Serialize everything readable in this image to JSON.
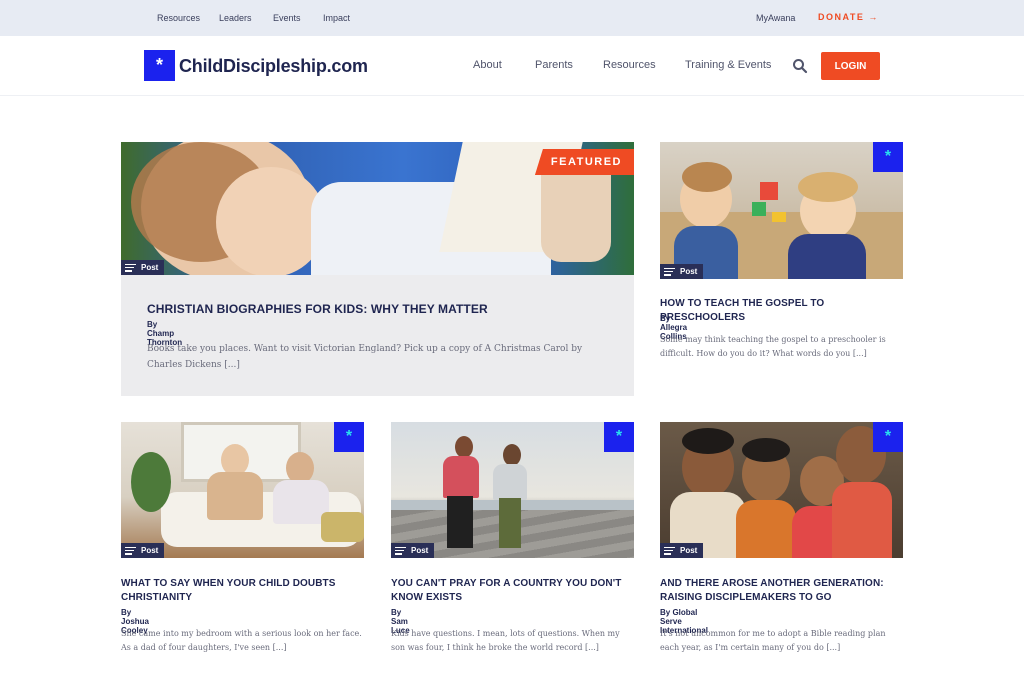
{
  "utility": {
    "links": [
      "Resources",
      "Leaders",
      "Events",
      "Impact"
    ],
    "myawana": "MyAwana",
    "donate": "DONATE →"
  },
  "brand": {
    "logo_text": "ChildDiscipleship.com",
    "logo_mark": "*"
  },
  "nav": {
    "items": [
      "About",
      "Parents",
      "Resources",
      "Training & Events"
    ],
    "search_icon": "search-icon",
    "login": "LOGIN"
  },
  "colors": {
    "accent": "#ef4b23",
    "brand_blue": "#1b22ee",
    "navy": "#1f2550",
    "utility_bg": "#e7ebf3"
  },
  "featured": {
    "badge": "FEATURED",
    "tag": "Post",
    "title": "CHRISTIAN BIOGRAPHIES FOR KIDS: WHY THEY MATTER",
    "author": "By Champ Thornton",
    "excerpt": "Books take you places. Want to visit Victorian England? Pick up a copy of A Christmas Carol by Charles Dickens [...]"
  },
  "posts": [
    {
      "tag": "Post",
      "title": "HOW TO TEACH THE GOSPEL TO PRESCHOOLERS",
      "author": "By Allegra Collins",
      "excerpt": "Some may think teaching the gospel to a preschooler is difficult. How do you do it? What words do you [...]"
    },
    {
      "tag": "Post",
      "title": "WHAT TO SAY WHEN YOUR CHILD DOUBTS CHRISTIANITY",
      "author": "By Joshua Cooley",
      "excerpt": "She came into my bedroom with a serious look on her face. As a dad of four daughters, I've seen [...]"
    },
    {
      "tag": "Post",
      "title": "YOU CAN'T PRAY FOR A COUNTRY YOU DON'T KNOW EXISTS",
      "author": "By Sam Luce",
      "excerpt": "Kids have questions. I mean, lots of questions. When my son was four, I think he broke the world record [...]"
    },
    {
      "tag": "Post",
      "title": "AND THERE AROSE ANOTHER GENERATION: RAISING DISCIPLEMAKERS TO GO",
      "author": "By Global Serve International",
      "excerpt": "It's not uncommon for me to adopt a Bible reading plan each year, as I'm certain many of you do [...]"
    }
  ]
}
